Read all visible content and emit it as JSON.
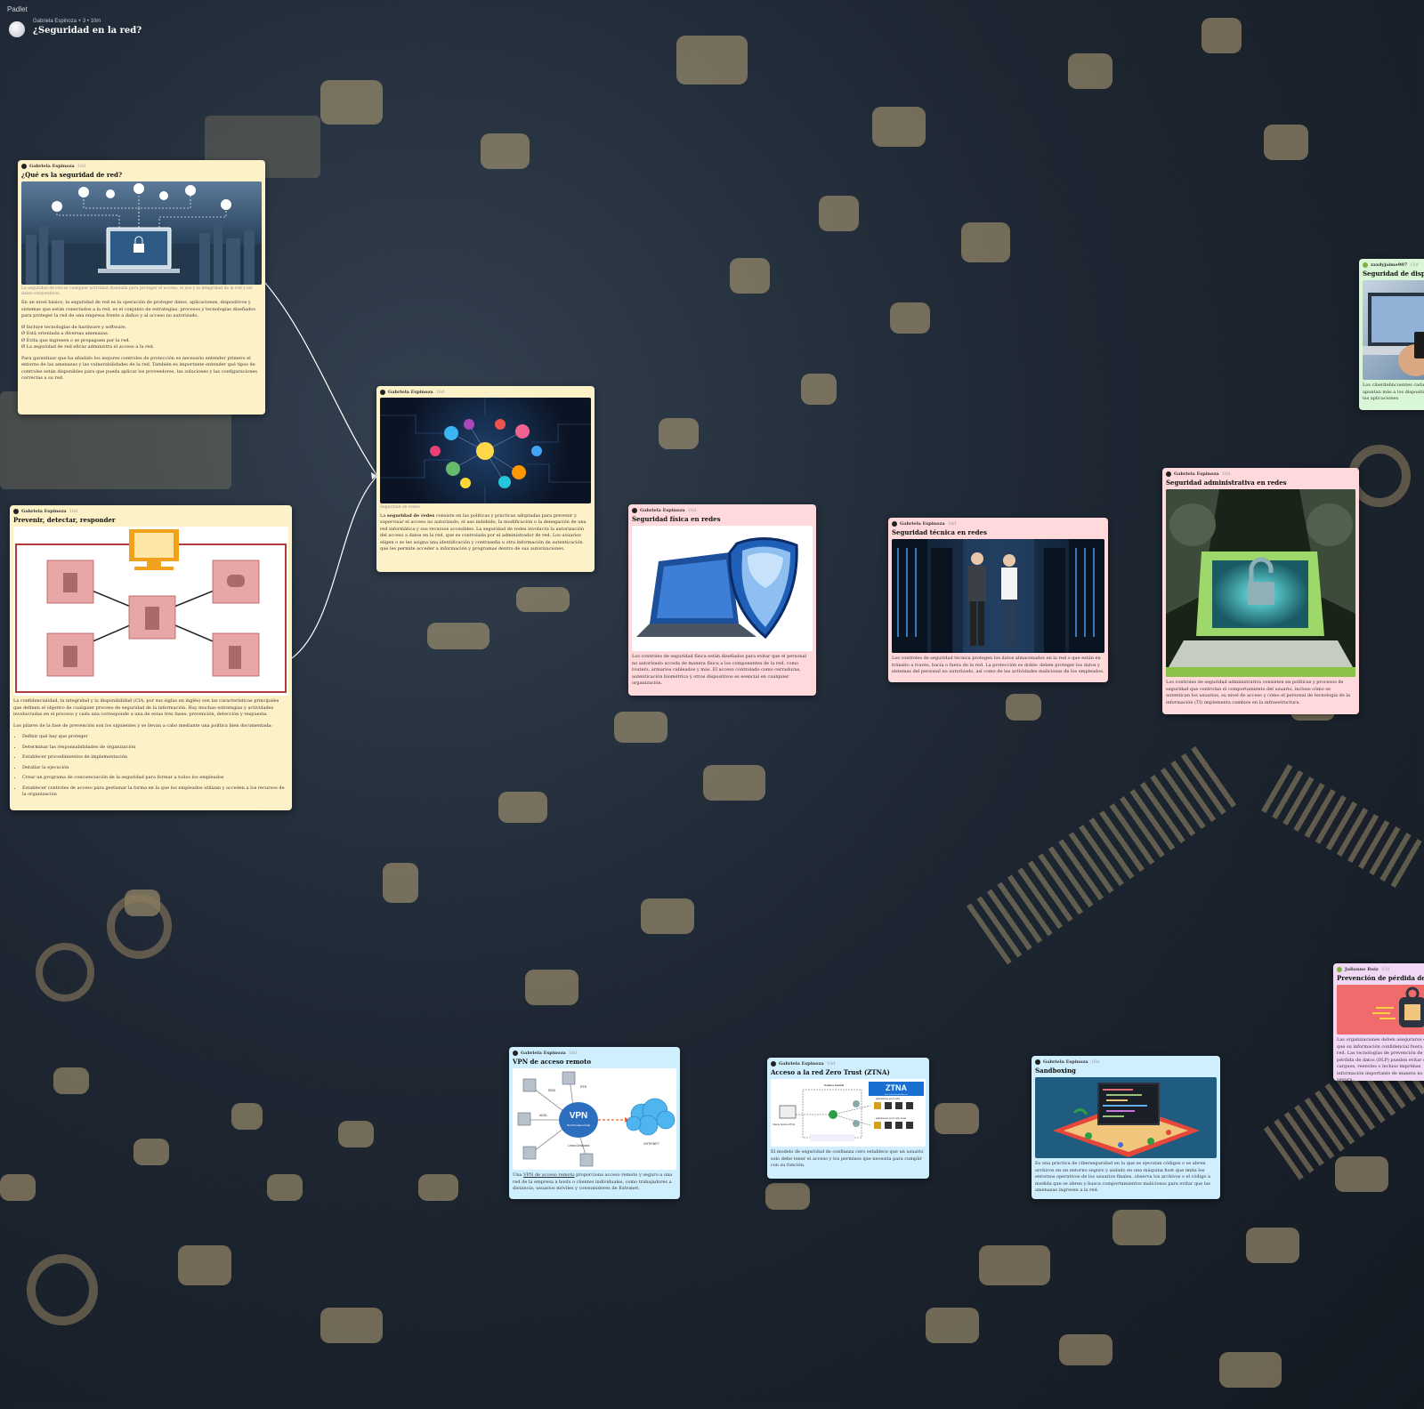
{
  "app": {
    "brand": "Padlet"
  },
  "header": {
    "meta": "Gabriela Espinoza + 3 • 10m",
    "title": "¿Seguridad en la red?"
  },
  "cards": {
    "que_es": {
      "author": "Gabriela Espinoza",
      "time": "16d",
      "title": "¿Qué es la seguridad de red?",
      "caption": "La seguridad de red es cualquier actividad diseñada para proteger el acceso, el uso y la integridad de la red y los datos corporativos.",
      "p1": "En un nivel básico, la seguridad de red es la operación de proteger datos, aplicaciones, dispositivos y sistemas que están conectados a la red, es el conjunto de estrategias, procesos y tecnologías diseñados para proteger la red de una empresa frente a daños y al acceso no autorizado.",
      "bullets": [
        "Ø Incluye tecnologías de hardware y software.",
        "Ø Está orientada a diversas amenazas.",
        "Ø Evita que ingresen o se propaguen por la red.",
        "Ø La seguridad de red eficaz administra el acceso a la red."
      ],
      "p2": "Para garantizar que ha añadido los mejores controles de protección es necesario entender primero el entorno de las amenazas y las vulnerabilidades de la red. También es importante entender qué tipos de controles están disponibles para que pueda aplicar los proveedores, las soluciones y las configuraciones correctas a su red."
    },
    "prevenir": {
      "author": "Gabriela Espinoza",
      "time": "16d",
      "title": "Prevenir, detectar, responder",
      "p1": "La confidencialidad, la integridad y la disponibilidad (CIA, por sus siglas en inglés) son las características principales que definen el objetivo de cualquier proceso de seguridad de la información. Hay muchas estrategias y actividades involucradas en el proceso y cada una corresponde a una de estas tres fases: prevención, detección y respuesta.",
      "p2": "Los pilares de la fase de prevención son los siguientes y se llevan a cabo mediante una política bien documentada:",
      "list": [
        "Definir qué hay que proteger",
        "Determinar las responsabilidades de organización",
        "Establecer procedimientos de implementación",
        "Detallar la ejecución",
        "Crear un programa de concienciación de la seguridad para formar a todos los empleados",
        "Establecer controles de acceso para gestionar la forma en la que los empleados utilizan y acceden a los recursos de la organización"
      ]
    },
    "seg_redes": {
      "author": "Gabriela Espinoza",
      "time": "16d",
      "caption": "Seguridad de redes",
      "lead": "La ",
      "bold": "seguridad de redes",
      "text": " consiste en las políticas y prácticas adoptadas para prevenir y supervisar el acceso no autorizado, el uso indebido, la modificación o la denegación de una red informática y sus recursos accesibles. La seguridad de redes involucra la autorización del acceso a datos en la red, que es controlada por el administrador de red. Los usuarios eligen o se les asigna una identificación y contraseña u otra información de autenticación que les permite acceder a información y programas dentro de sus autorizaciones."
    },
    "fisica": {
      "author": "Gabriela Espinoza",
      "time": "16d",
      "title": "Seguridad física en redes",
      "text": "Los controles de seguridad física están diseñados para evitar que el personal no autorizado acceda de manera física a los componentes de la red, como routers, armarios cableados y más. El acceso controlado como cerraduras, autenticación biométrica y otros dispositivos es esencial en cualquier organización."
    },
    "tecnica": {
      "author": "Gabriela Espinoza",
      "time": "16d",
      "title": "Seguridad técnica en redes",
      "text": "Los controles de seguridad técnica protegen los datos almacenados en la red o que están en tránsito a través, hacia o fuera de la red. La protección es doble: deben proteger los datos y sistemas del personal no autorizado, así como de las actividades maliciosas de los empleados."
    },
    "administrativa": {
      "author": "Gabriela Espinoza",
      "time": "16d",
      "title": "Seguridad administrativa en redes",
      "text": "Los controles de seguridad administrativa consisten en políticas y procesos de seguridad que controlan el comportamiento del usuario, incluso cómo se autentican los usuarios, su nivel de acceso y cómo el personal de tecnología de la información (TI) implementa cambios en la infraestructura."
    },
    "dispositivos": {
      "author": "xxxdyjaime907",
      "time": "15d",
      "title": "Seguridad de dispositivos",
      "text": "Los ciberdelincuentes cada vez apuntan más a los dispositivos y las aplicaciones"
    },
    "vpn": {
      "author": "Gabriela Espinoza",
      "time": "16d",
      "title": "VPN de acceso remoto",
      "lead": "Una ",
      "link": "VPN de acceso remoto",
      "text": " proporciona acceso remoto y seguro a una red de la empresa a hosts o clientes individuales, como trabajadores a distancia, usuarios móviles y consumidores de Extranet."
    },
    "ztna": {
      "author": "Gabriela Espinoza",
      "time": "16d",
      "title": "Acceso a la red Zero Trust (ZTNA)",
      "text": "El modelo de seguridad de confianza cero establece que un usuario solo debe tener el acceso y los permisos que necesita para cumplir con su función."
    },
    "sandboxing": {
      "author": "Gabriela Espinoza",
      "time": "16d",
      "title": "Sandboxing",
      "text": "Es una práctica de ciberseguridad en la que se ejecutan códigos o se abren archivos en un entorno seguro y aislado en una máquina host que imita los entornos operativos de los usuarios finales. observa los archivos o el código a medida que se abren y busca comportamientos maliciosos para evitar que las amenazas ingresen a la red."
    },
    "dlp": {
      "author": "Julianne Ruiz",
      "time": "15d",
      "title": "Prevención de pérdida de datos",
      "text": "Las organizaciones deben asegurarse de que su información confidencial fuera de la red. Las tecnologías de prevención de pérdida de datos (DLP) pueden evitar que cargues, reenvíes o incluso imprimas información importante de manera no segura."
    }
  },
  "image_labels": {
    "vpn": {
      "big": "VPN",
      "sub": "Red Privada Virtual",
      "adsl": "ADSL",
      "rdsi": "RDSI",
      "rtb": "RTB",
      "dedicada": "Linea Dedicada",
      "internet": "INTERNET"
    },
    "ztna": {
      "badge": "ZTNA",
      "sub": "Zero Trust Network Access",
      "central": "Sophos Central",
      "cliente": "Cliente Sophos ZTNA",
      "nube": "aplicaciones en la nube",
      "local": "aplicaciones en la nube Local"
    }
  },
  "colors": {
    "yellow": "#fdf1c8",
    "pink": "#ffd9dc",
    "blue": "#cfeefe",
    "green": "#d9f6d6",
    "purple": "#f1d8f4"
  }
}
